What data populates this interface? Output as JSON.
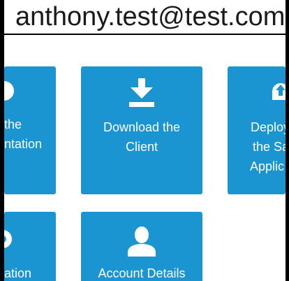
{
  "header": {
    "email": "anthony.test@test.com"
  },
  "tiles": [
    {
      "icon": "circle-icon",
      "line1": "the",
      "line2": "ntation",
      "line3": ""
    },
    {
      "icon": "download-icon",
      "line1": "Download the",
      "line2": "Client",
      "line3": ""
    },
    {
      "icon": "cloud-upload-icon",
      "line1": "Deploy",
      "line2": "the Sa",
      "line3": "Applic"
    },
    {
      "icon": "circle-icon",
      "line1": "ation",
      "line2": "",
      "line3": ""
    },
    {
      "icon": "user-icon",
      "line1": "Account Details",
      "line2": "",
      "line3": ""
    }
  ],
  "colors": {
    "tile_background": "#1a95d2",
    "tile_text": "#ffffff",
    "header_text": "#1a1a1a"
  }
}
